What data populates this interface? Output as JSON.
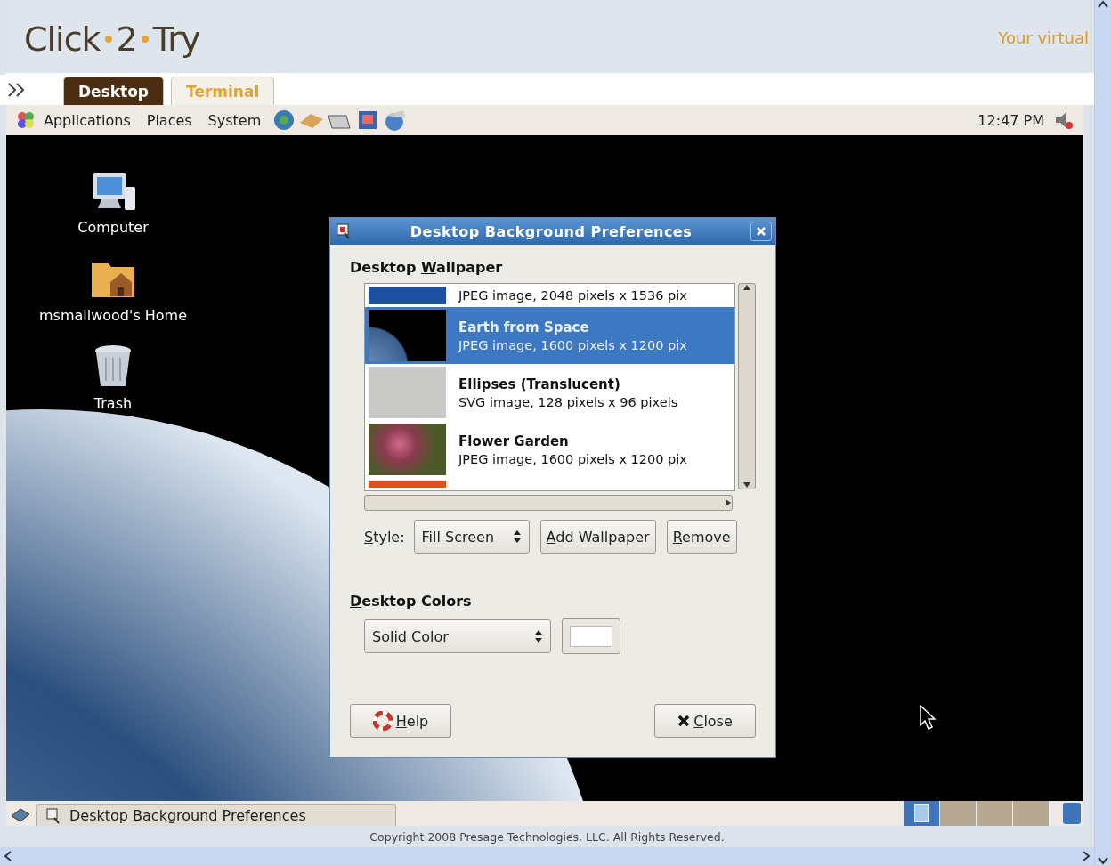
{
  "header": {
    "logo": [
      "Click",
      "2",
      "Try"
    ],
    "tagline": "Your virtual"
  },
  "tabs": [
    {
      "label": "Desktop",
      "selected": true
    },
    {
      "label": "Terminal",
      "selected": false
    }
  ],
  "panel": {
    "menus": [
      "Applications",
      "Places",
      "System"
    ],
    "clock": "12:47 PM"
  },
  "desktop_icons": [
    {
      "kind": "computer",
      "label": "Computer"
    },
    {
      "kind": "home",
      "label": "msmallwood's Home"
    },
    {
      "kind": "trash",
      "label": "Trash"
    }
  ],
  "dialog": {
    "title": "Desktop Background Preferences",
    "wallpaper_heading": {
      "before": "Desktop ",
      "key": "W",
      "after": "allpaper"
    },
    "wallpapers": [
      {
        "kind": "logo",
        "subtitle": "JPEG image, 2048 pixels x 1536 pix",
        "selected": false
      },
      {
        "kind": "earth",
        "title": "Earth from Space",
        "subtitle": "JPEG image, 1600 pixels x 1200 pix",
        "selected": true
      },
      {
        "kind": "plain",
        "title": "Ellipses (Translucent)",
        "subtitle": "SVG image, 128 pixels x 96 pixels",
        "selected": false
      },
      {
        "kind": "flowers",
        "title": "Flower Garden",
        "subtitle": "JPEG image, 1600 pixels x 1200 pix",
        "selected": false
      },
      {
        "kind": "orange",
        "selected": false
      }
    ],
    "style_label": {
      "key": "S",
      "after": "tyle:"
    },
    "style_value": "Fill Screen",
    "buttons": [
      {
        "key": "A",
        "after": "dd Wallpaper"
      },
      {
        "key": "R",
        "after": "emove"
      }
    ],
    "colors_heading": {
      "key": "D",
      "after": "esktop Colors"
    },
    "color_mode": "Solid Color",
    "help": {
      "key": "H",
      "after": "elp"
    },
    "close": {
      "key": "C",
      "after": "lose"
    }
  },
  "taskbar": {
    "tasks": [
      {
        "label": "Desktop Background Preferences"
      }
    ],
    "workspaces": [
      {
        "selected": true
      },
      {
        "selected": false
      },
      {
        "selected": false
      },
      {
        "selected": false
      }
    ]
  },
  "copyright": "Copyright 2008 Presage Technologies, LLC. All Rights Reserved."
}
